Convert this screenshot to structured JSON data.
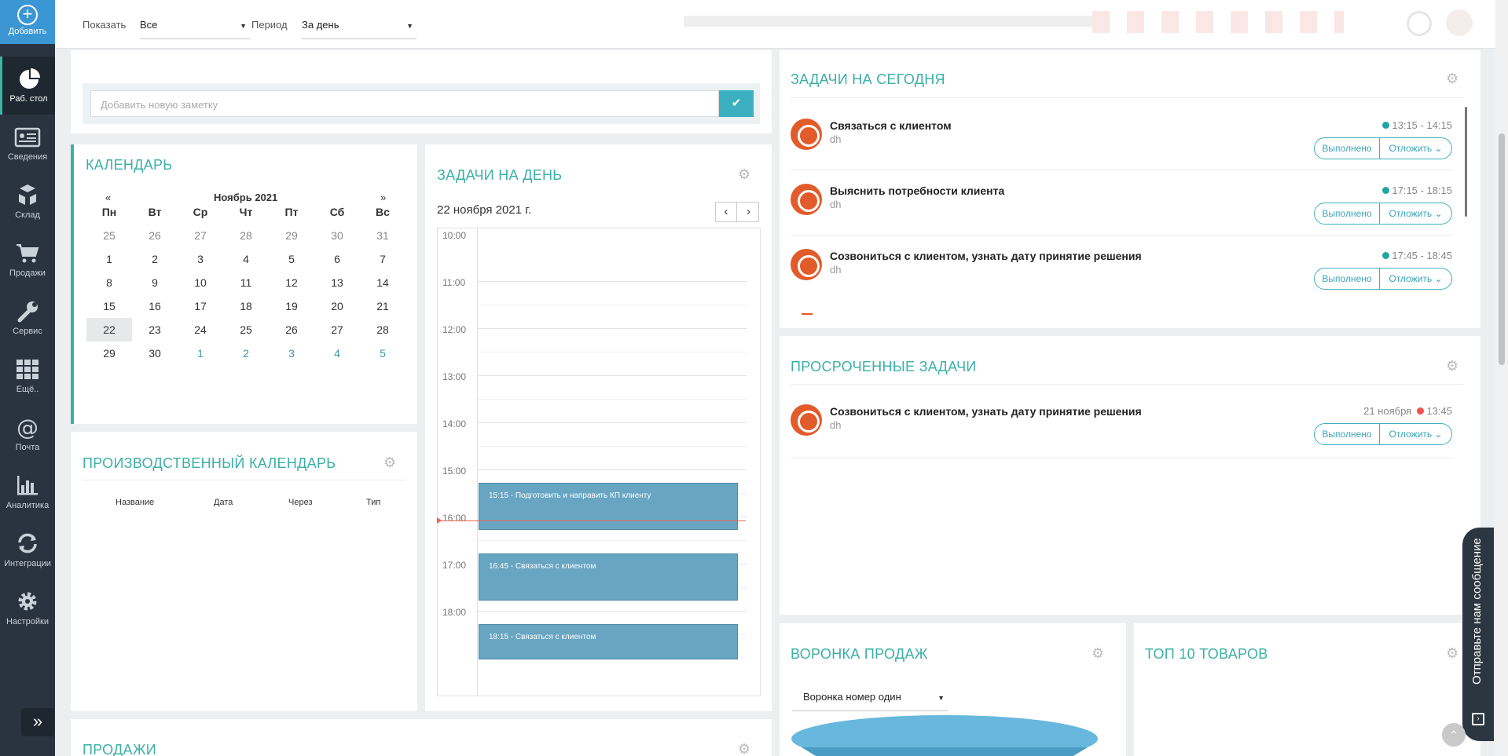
{
  "sidebar": {
    "add_label": "Добавить",
    "items": [
      {
        "label": "Раб. стол",
        "icon": "pie-chart-icon"
      },
      {
        "label": "Сведения",
        "icon": "id-card-icon"
      },
      {
        "label": "Склад",
        "icon": "boxes-icon"
      },
      {
        "label": "Продажи",
        "icon": "cart-icon"
      },
      {
        "label": "Сервис",
        "icon": "wrench-icon"
      },
      {
        "label": "Ещё..",
        "icon": "grid-icon"
      },
      {
        "label": "Почта",
        "icon": "at-icon"
      },
      {
        "label": "Аналитика",
        "icon": "bar-chart-icon"
      },
      {
        "label": "Интеграции",
        "icon": "sync-icon"
      },
      {
        "label": "Настройки",
        "icon": "gear-icon"
      }
    ]
  },
  "filters": {
    "show_label": "Показать",
    "show_value": "Все",
    "period_label": "Период",
    "period_value": "За день"
  },
  "note": {
    "placeholder": "Добавить новую заметку"
  },
  "calendar": {
    "title": "КАЛЕНДАРЬ",
    "prev": "«",
    "next": "»",
    "month": "Ноябрь 2021",
    "weekdays": [
      "Пн",
      "Вт",
      "Ср",
      "Чт",
      "Пт",
      "Сб",
      "Вс"
    ],
    "weeks": [
      [
        "25",
        "26",
        "27",
        "28",
        "29",
        "30",
        "31"
      ],
      [
        "1",
        "2",
        "3",
        "4",
        "5",
        "6",
        "7"
      ],
      [
        "8",
        "9",
        "10",
        "11",
        "12",
        "13",
        "14"
      ],
      [
        "15",
        "16",
        "17",
        "18",
        "19",
        "20",
        "21"
      ],
      [
        "22",
        "23",
        "24",
        "25",
        "26",
        "27",
        "28"
      ],
      [
        "29",
        "30",
        "1",
        "2",
        "3",
        "4",
        "5"
      ]
    ],
    "selected": "22"
  },
  "prod_calendar": {
    "title": "ПРОИЗВОДСТВЕННЫЙ КАЛЕНДАРЬ",
    "columns": [
      "Название",
      "Дата",
      "Через",
      "Тип"
    ]
  },
  "sales": {
    "title": "ПРОДАЖИ"
  },
  "day_tasks": {
    "title": "ЗАДАЧИ НА ДЕНЬ",
    "date": "22 ноября 2021 г.",
    "hours": [
      "10:00",
      "11:00",
      "12:00",
      "13:00",
      "14:00",
      "15:00",
      "16:00",
      "17:00",
      "18:00"
    ],
    "events": [
      {
        "text": "15:15 - Подготовить и направить КП клиенту"
      },
      {
        "text": "16:45 - Связаться с клиентом"
      },
      {
        "text": "18:15 - Связаться с клиентом"
      }
    ]
  },
  "today_tasks": {
    "title": "ЗАДАЧИ НА СЕГОДНЯ",
    "items": [
      {
        "name": "Связаться с клиентом",
        "owner": "dh",
        "time": "13:15 - 14:15"
      },
      {
        "name": "Выяснить потребности клиента",
        "owner": "dh",
        "time": "17:15 - 18:15"
      },
      {
        "name": "Созвониться с клиентом, узнать дату принятие решения",
        "owner": "dh",
        "time": "17:45 - 18:45"
      }
    ],
    "done_label": "Выполнено",
    "later_label": "Отложить"
  },
  "overdue_tasks": {
    "title": "ПРОСРОЧЕННЫЕ ЗАДАЧИ",
    "items": [
      {
        "name": "Созвониться с клиентом, узнать дату принятие решения",
        "owner": "dh",
        "date": "21 ноября",
        "time": "13:45"
      }
    ],
    "done_label": "Выполнено",
    "later_label": "Отложить"
  },
  "funnel": {
    "title": "ВОРОНКА ПРОДАЖ",
    "selected": "Воронка номер один"
  },
  "top_products": {
    "title": "ТОП 10 ТОВАРОВ"
  },
  "chat": {
    "label": "Отправьте нам сообщение"
  },
  "colors": {
    "accent": "#3bb0a6",
    "sidebar": "#2a3440",
    "event": "#67a5c2",
    "ok_dot": "#20a5a0",
    "overdue_dot": "#f05050"
  }
}
